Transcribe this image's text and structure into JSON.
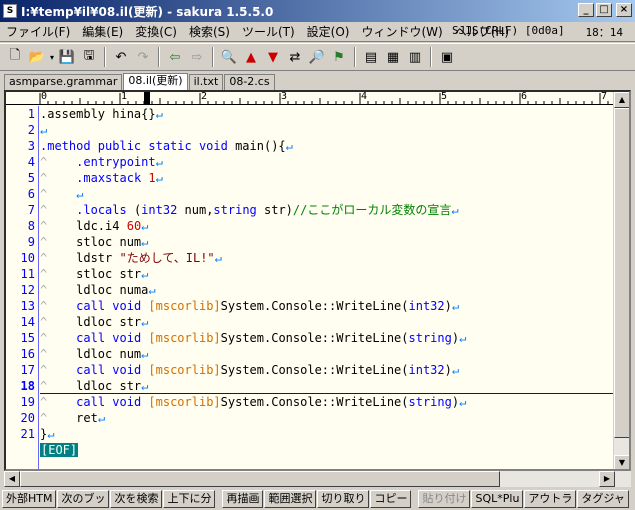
{
  "window": {
    "title": "I:¥temp¥il¥08.il(更新) - sakura 1.5.5.0",
    "app_icon_text": "S",
    "buttons": {
      "minimize": "_",
      "maximize": "□",
      "close": "×"
    }
  },
  "menu": {
    "items": [
      "ファイル(F)",
      "編集(E)",
      "変換(C)",
      "検索(S)",
      "ツール(T)",
      "設定(O)",
      "ウィンドウ(W)",
      "ヘルプ(H)"
    ],
    "encoding_status": "SJIS(CRLF) [0d0a]",
    "position_status": "18：14"
  },
  "toolbar": {
    "icons": [
      "new-file-icon",
      "open-folder-icon",
      "dropdown-icon",
      "save-icon",
      "save-all-icon",
      "undo-icon",
      "redo-icon",
      "prev-jump-icon",
      "next-jump-icon",
      "find-icon",
      "find-prev-icon",
      "find-next-icon",
      "replace-icon",
      "grep-icon",
      "tag-jump-icon",
      "compare-icon",
      "outline-icon",
      "settings-icon",
      "keymacro-icon",
      "window-icon"
    ]
  },
  "tabs": [
    {
      "label": "asmparse.grammar",
      "active": false
    },
    {
      "label": "08.il(更新)",
      "active": true
    },
    {
      "label": "il.txt",
      "active": false
    },
    {
      "label": "08-2.cs",
      "active": false
    }
  ],
  "ruler": {
    "labels": [
      "0",
      "1",
      "2",
      "3",
      "4",
      "5",
      "6",
      "7"
    ]
  },
  "editor": {
    "current_line": 18,
    "lines": [
      {
        "no": "1",
        "html": ".assembly hina{}<span class='crlf'>↵</span>"
      },
      {
        "no": "2",
        "html": "<span class='crlf'>↵</span>"
      },
      {
        "no": "3",
        "html": "<span class='kw'>.method public static void</span> main(){<span class='crlf'>↵</span>"
      },
      {
        "no": "4",
        "html": "<span class='tabm'>^</span>    <span class='kw'>.entrypoint</span><span class='crlf'>↵</span>"
      },
      {
        "no": "5",
        "html": "<span class='tabm'>^</span>    <span class='kw'>.maxstack</span> <span class='num'>1</span><span class='crlf'>↵</span>"
      },
      {
        "no": "6",
        "html": "<span class='tabm'>^</span>    <span class='crlf'>↵</span>"
      },
      {
        "no": "7",
        "html": "<span class='tabm'>^</span>    <span class='kw'>.locals</span> (<span class='kw'>int32</span> num,<span class='kw'>string</span> str)<span class='cm'>//ここがローカル変数の宣言</span><span class='crlf'>↵</span>"
      },
      {
        "no": "8",
        "html": "<span class='tabm'>^</span>    ldc.i4 <span class='num'>60</span><span class='crlf'>↵</span>"
      },
      {
        "no": "9",
        "html": "<span class='tabm'>^</span>    stloc num<span class='crlf'>↵</span>"
      },
      {
        "no": "10",
        "html": "<span class='tabm'>^</span>    ldstr <span class='str'>\"ためして、IL!\"</span><span class='crlf'>↵</span>"
      },
      {
        "no": "11",
        "html": "<span class='tabm'>^</span>    stloc str<span class='crlf'>↵</span>"
      },
      {
        "no": "12",
        "html": "<span class='tabm'>^</span>    ldloc numa<span class='crlf'>↵</span>"
      },
      {
        "no": "13",
        "html": "<span class='tabm'>^</span>    <span class='kw'>call void</span> <span class='br'>[mscorlib]</span>System.Console::WriteLine(<span class='kw'>int32</span>)<span class='crlf'>↵</span>"
      },
      {
        "no": "14",
        "html": "<span class='tabm'>^</span>    ldloc str<span class='crlf'>↵</span>"
      },
      {
        "no": "15",
        "html": "<span class='tabm'>^</span>    <span class='kw'>call void</span> <span class='br'>[mscorlib]</span>System.Console::WriteLine(<span class='kw'>string</span>)<span class='crlf'>↵</span>"
      },
      {
        "no": "16",
        "html": "<span class='tabm'>^</span>    ldloc num<span class='crlf'>↵</span>"
      },
      {
        "no": "17",
        "html": "<span class='tabm'>^</span>    <span class='kw'>call void</span> <span class='br'>[mscorlib]</span>System.Console::WriteLine(<span class='kw'>int32</span>)<span class='crlf'>↵</span>"
      },
      {
        "no": "18",
        "html": "<span class='tabm'>^</span>    ldloc str<span class='crlf'>↵</span>"
      },
      {
        "no": "19",
        "html": "<span class='tabm'>^</span>    <span class='kw'>call void</span> <span class='br'>[mscorlib]</span>System.Console::WriteLine(<span class='kw'>string</span>)<span class='crlf'>↵</span>"
      },
      {
        "no": "20",
        "html": "<span class='tabm'>^</span>    ret<span class='crlf'>↵</span>"
      },
      {
        "no": "21",
        "html": "}<span class='crlf'>↵</span>"
      },
      {
        "no": "",
        "html": "<span class='eof'>[EOF]</span>"
      }
    ]
  },
  "fkeys": [
    {
      "label": "外部HTM",
      "enabled": true
    },
    {
      "label": "次のブッ",
      "enabled": true
    },
    {
      "label": "次を検索",
      "enabled": true
    },
    {
      "label": "上下に分",
      "enabled": true
    },
    {
      "label": "再描画",
      "enabled": true
    },
    {
      "label": "範囲選択",
      "enabled": true
    },
    {
      "label": "切り取り",
      "enabled": true
    },
    {
      "label": "コピー",
      "enabled": true
    },
    {
      "label": "貼り付け",
      "enabled": false
    },
    {
      "label": "SQL*Plu",
      "enabled": true
    },
    {
      "label": "アウトラ",
      "enabled": true
    },
    {
      "label": "タグジャ",
      "enabled": true
    }
  ],
  "colors": {
    "keyword": "#0000ff",
    "number": "#d00000",
    "comment": "#008000",
    "bracket": "#d07000",
    "background": "#fffef0"
  }
}
